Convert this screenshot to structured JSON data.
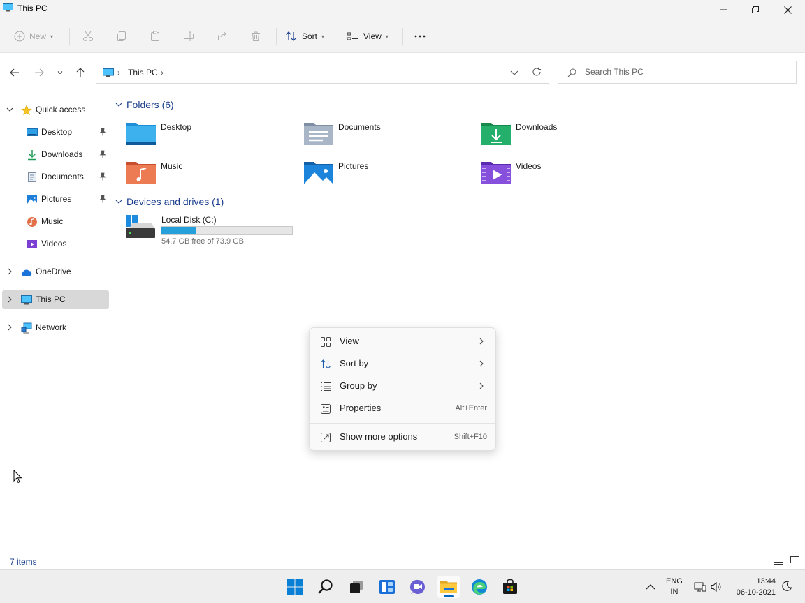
{
  "window": {
    "title": "This PC",
    "minimize_icon": "minimize-icon",
    "maximize_icon": "restore-icon",
    "close_icon": "close-icon"
  },
  "toolbar": {
    "new_label": "New",
    "sort_label": "Sort",
    "view_label": "View",
    "disabled_icons": [
      "cut-icon",
      "copy-icon",
      "paste-icon",
      "rename-icon",
      "share-icon",
      "delete-icon"
    ],
    "more_icon": "more-icon"
  },
  "address": {
    "crumb": "This PC",
    "search_placeholder": "Search This PC"
  },
  "navigation": {
    "quick_access": "Quick access",
    "items": [
      {
        "label": "Desktop",
        "pinned": true
      },
      {
        "label": "Downloads",
        "pinned": true
      },
      {
        "label": "Documents",
        "pinned": true
      },
      {
        "label": "Pictures",
        "pinned": true
      },
      {
        "label": "Music",
        "pinned": false
      },
      {
        "label": "Videos",
        "pinned": false
      }
    ],
    "onedrive": "OneDrive",
    "this_pc": "This PC",
    "network": "Network"
  },
  "content": {
    "folders_header": "Folders (6)",
    "folders": [
      {
        "label": "Desktop",
        "icon": "desktop-folder-icon"
      },
      {
        "label": "Documents",
        "icon": "documents-folder-icon"
      },
      {
        "label": "Downloads",
        "icon": "downloads-folder-icon"
      },
      {
        "label": "Music",
        "icon": "music-folder-icon"
      },
      {
        "label": "Pictures",
        "icon": "pictures-folder-icon"
      },
      {
        "label": "Videos",
        "icon": "videos-folder-icon"
      }
    ],
    "devices_header": "Devices and drives (1)",
    "drive": {
      "label": "Local Disk (C:)",
      "free_text": "54.7 GB free of 73.9 GB",
      "used_fraction": 0.26
    }
  },
  "context_menu": {
    "items": [
      {
        "label": "View",
        "submenu": true,
        "icon": "grid-view-icon"
      },
      {
        "label": "Sort by",
        "submenu": true,
        "icon": "sort-icon"
      },
      {
        "label": "Group by",
        "submenu": true,
        "icon": "group-by-icon"
      },
      {
        "label": "Properties",
        "shortcut": "Alt+Enter",
        "icon": "properties-icon"
      },
      {
        "label": "Show more options",
        "shortcut": "Shift+F10",
        "icon": "more-options-icon"
      }
    ]
  },
  "status": {
    "items_count": "7 items"
  },
  "taskbar": {
    "icons": [
      "start-icon",
      "search-icon",
      "task-view-icon",
      "widgets-icon",
      "chat-icon",
      "file-explorer-icon",
      "edge-icon",
      "store-icon"
    ],
    "active": "file-explorer-icon",
    "lang_top": "ENG",
    "lang_bottom": "IN",
    "time": "13:44",
    "date": "06-10-2021"
  },
  "colors": {
    "accent": "#0067c0",
    "link_blue": "#1a3e8c",
    "drive_bar": "#26a0da"
  }
}
